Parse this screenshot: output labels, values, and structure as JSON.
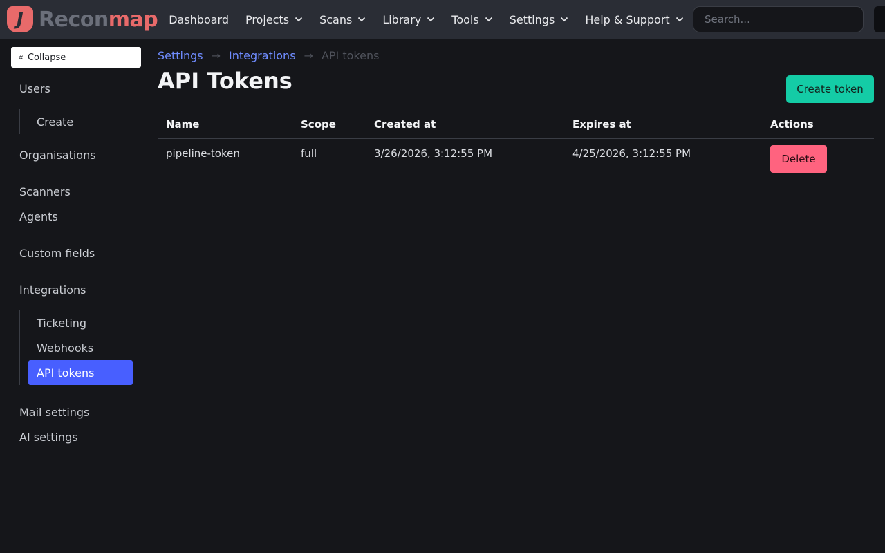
{
  "brand": {
    "logo_glyph": "J",
    "name_a": "Recon",
    "name_b": "map"
  },
  "nav": {
    "items": [
      {
        "label": "Dashboard",
        "has_dropdown": false
      },
      {
        "label": "Projects",
        "has_dropdown": true
      },
      {
        "label": "Scans",
        "has_dropdown": true
      },
      {
        "label": "Library",
        "has_dropdown": true
      },
      {
        "label": "Tools",
        "has_dropdown": true
      },
      {
        "label": "Settings",
        "has_dropdown": true
      },
      {
        "label": "Help & Support",
        "has_dropdown": true
      }
    ],
    "search_placeholder": "Search..."
  },
  "sidebar": {
    "collapse_label": "Collapse",
    "collapse_icon": "«",
    "users": "Users",
    "users_create": "Create",
    "organisations": "Organisations",
    "scanners": "Scanners",
    "agents": "Agents",
    "custom_fields": "Custom fields",
    "integrations": "Integrations",
    "ticketing": "Ticketing",
    "webhooks": "Webhooks",
    "api_tokens": "API tokens",
    "mail_settings": "Mail settings",
    "ai_settings": "AI settings"
  },
  "breadcrumb": {
    "settings": "Settings",
    "integrations": "Integrations",
    "current": "API tokens",
    "separator": "→"
  },
  "page": {
    "title": "API Tokens",
    "create_button": "Create token"
  },
  "table": {
    "headers": {
      "name": "Name",
      "scope": "Scope",
      "created": "Created at",
      "expires": "Expires at",
      "actions": "Actions"
    },
    "rows": [
      {
        "name": "pipeline-token",
        "scope": "full",
        "created": "3/26/2026, 3:12:55 PM",
        "expires": "4/25/2026, 3:12:55 PM",
        "action": "Delete"
      }
    ]
  },
  "colors": {
    "navbar": "#2a2d35",
    "background": "#15161a",
    "brand_red": "#e86a6a",
    "active_item": "#485fff",
    "create_button": "#14cca6",
    "delete_button": "#ff637f",
    "link": "#6f8cff"
  }
}
